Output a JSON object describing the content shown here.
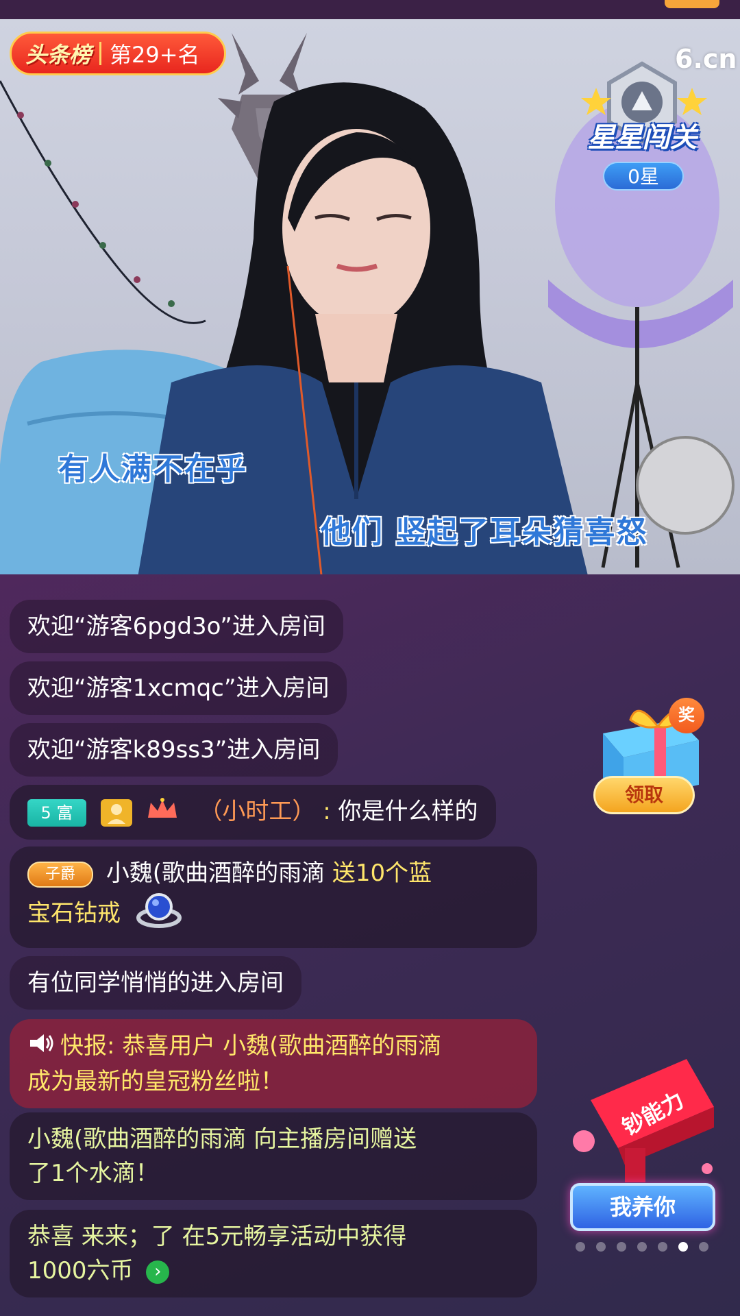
{
  "video": {
    "rank_badge": {
      "title": "头条榜",
      "value": "第29+名"
    },
    "logo": "6.cn",
    "star_level": {
      "title": "星星闯关",
      "count": "0星"
    },
    "lyrics": [
      "有人满不在乎",
      "他们  竖起了耳朵猜喜怒"
    ]
  },
  "chat": {
    "messages": [
      {
        "text": "欢迎“游客6pgd3o”进入房间"
      },
      {
        "text": "欢迎“游客1xcmqc”进入房间"
      },
      {
        "text": "欢迎“游客k89ss3”进入房间"
      },
      {
        "badge": "5 富",
        "user": "（小时工）",
        "sep": ":",
        "text": " 你是什么样的"
      },
      {
        "badge": "子爵",
        "user": "小魏(歌曲酒醉的雨滴",
        "action": " 送10个蓝",
        "action2": "宝石钻戒"
      },
      {
        "text": "有位同学悄悄的进入房间"
      },
      {
        "prefix": "快报:",
        "line1": " 恭喜用户 小魏(歌曲酒醉的雨滴",
        "line2": "成为最新的皇冠粉丝啦！"
      },
      {
        "line1": "小魏(歌曲酒醉的雨滴 向主播房间赠送",
        "line2": "了1个水滴！"
      },
      {
        "line1": "恭喜 来来；了  在5元畅享活动中获得",
        "line2": "1000六币"
      }
    ]
  },
  "widgets": {
    "gift": {
      "tag": "奖",
      "button": "领取"
    },
    "promo": {
      "label": "钞能力",
      "button": "我养你"
    },
    "carousel": {
      "count": 7,
      "active_index": 5
    }
  },
  "colors": {
    "background": "#54285e",
    "rank_red": "#e8261e",
    "lyric_blue": "#2f78d8",
    "gold_text": "#ffe66b",
    "orange_text": "#ff9a55"
  }
}
